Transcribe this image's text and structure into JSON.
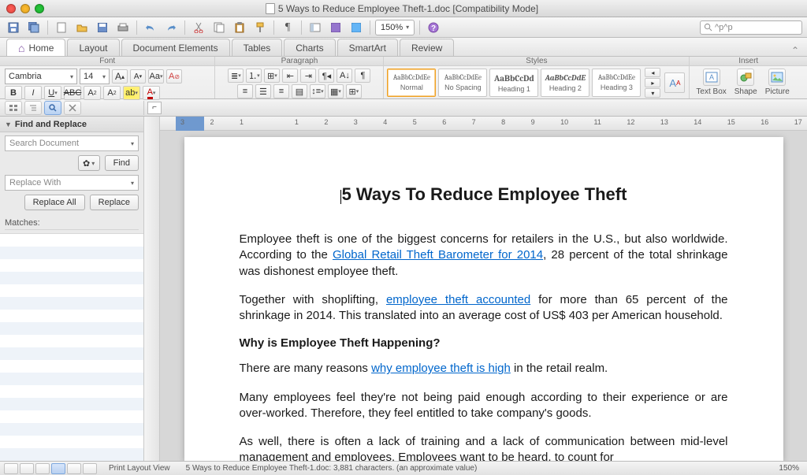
{
  "window": {
    "title": "5 Ways to Reduce Employee Theft-1.doc [Compatibility Mode]"
  },
  "qat": {
    "zoom": "150%",
    "search_value": "^p^p"
  },
  "tabs": [
    "Home",
    "Layout",
    "Document Elements",
    "Tables",
    "Charts",
    "SmartArt",
    "Review"
  ],
  "ribbon": {
    "groups": {
      "font": "Font",
      "paragraph": "Paragraph",
      "styles": "Styles",
      "insert": "Insert"
    },
    "font": {
      "name": "Cambria",
      "size": "14"
    },
    "styles": [
      {
        "preview": "AaBbCcDdEe",
        "label": "Normal",
        "sel": true
      },
      {
        "preview": "AaBbCcDdEe",
        "label": "No Spacing"
      },
      {
        "preview": "AaBbCcDd",
        "label": "Heading 1",
        "bold": true
      },
      {
        "preview": "AaBbCcDdE",
        "label": "Heading 2",
        "italic": true,
        "bold": true
      },
      {
        "preview": "AaBbCcDdEe",
        "label": "Heading 3"
      }
    ],
    "insert": [
      "Text Box",
      "Shape",
      "Picture"
    ]
  },
  "sidebar": {
    "title": "Find and Replace",
    "search_placeholder": "Search Document",
    "find": "Find",
    "replace_placeholder": "Replace With",
    "replace_all": "Replace All",
    "replace": "Replace",
    "matches": "Matches:"
  },
  "ruler_numbers": [
    "3",
    "2",
    "1",
    "",
    "1",
    "2",
    "3",
    "4",
    "5",
    "6",
    "7",
    "8",
    "9",
    "10",
    "11",
    "12",
    "13",
    "14",
    "15",
    "16",
    "17"
  ],
  "document": {
    "title": "5 Ways To Reduce Employee Theft",
    "p1a": "Employee theft is one of the biggest concerns for retailers in the U.S., but also worldwide. According to the ",
    "p1_link": "Global Retail Theft Barometer for 2014",
    "p1b": ", 28 percent of the total shrinkage was dishonest employee theft.",
    "p2a": "Together with shoplifting, ",
    "p2_link": "employee theft accounted",
    "p2b": " for more than 65 percent of the shrinkage in 2014. This translated into an average cost of US$ 403 per American household.",
    "h2": "Why is Employee Theft Happening?",
    "p3a": "There are many reasons ",
    "p3_link": "why employee theft is high",
    "p3b": " in the retail realm.",
    "p4": "Many employees feel they're not being paid enough according to their experience or are over-worked. Therefore, they feel entitled to take company's goods.",
    "p5": " As well, there is often a lack of training and a lack of communication between mid-level management and employees. Employees want to be heard, to count for"
  },
  "status": {
    "view": "Print Layout View",
    "info": "5 Ways to Reduce Employee Theft-1.doc: 3,881 characters. (an approximate value)",
    "zoom": "150%"
  }
}
